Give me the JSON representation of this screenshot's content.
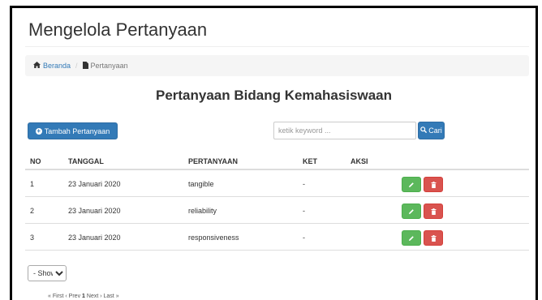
{
  "page": {
    "title": "Mengelola Pertanyaan"
  },
  "breadcrumb": {
    "home_label": "Beranda",
    "current_label": "Pertanyaan"
  },
  "section": {
    "title": "Pertanyaan Bidang Kemahasiswaan"
  },
  "toolbar": {
    "add_label": "Tambah Pertanyaan",
    "search_placeholder": "ketik keyword ...",
    "search_label": "Cari"
  },
  "table": {
    "headers": {
      "no": "NO",
      "tanggal": "TANGGAL",
      "pertanyaan": "PERTANYAAN",
      "ket": "KET",
      "aksi": "AKSI"
    },
    "rows": [
      {
        "no": "1",
        "tanggal": "23 Januari 2020",
        "pertanyaan": "tangible",
        "ket": "-"
      },
      {
        "no": "2",
        "tanggal": "23 Januari 2020",
        "pertanyaan": "reliability",
        "ket": "-"
      },
      {
        "no": "3",
        "tanggal": "23 Januari 2020",
        "pertanyaan": "responsiveness",
        "ket": "-"
      }
    ]
  },
  "show": {
    "selected": "- Show -"
  },
  "pagination": {
    "first": "« First",
    "prev": "‹ Prev",
    "current": "1",
    "next": "Next ›",
    "last": "Last »"
  },
  "icons": {
    "home": "home-icon",
    "file": "file-icon",
    "plus": "plus-circle-icon",
    "search": "search-icon",
    "edit": "pencil-icon",
    "delete": "trash-icon",
    "dropdown": "chevron-down-icon"
  },
  "colors": {
    "primary": "#337ab7",
    "success": "#5cb85c",
    "danger": "#d9534f"
  }
}
